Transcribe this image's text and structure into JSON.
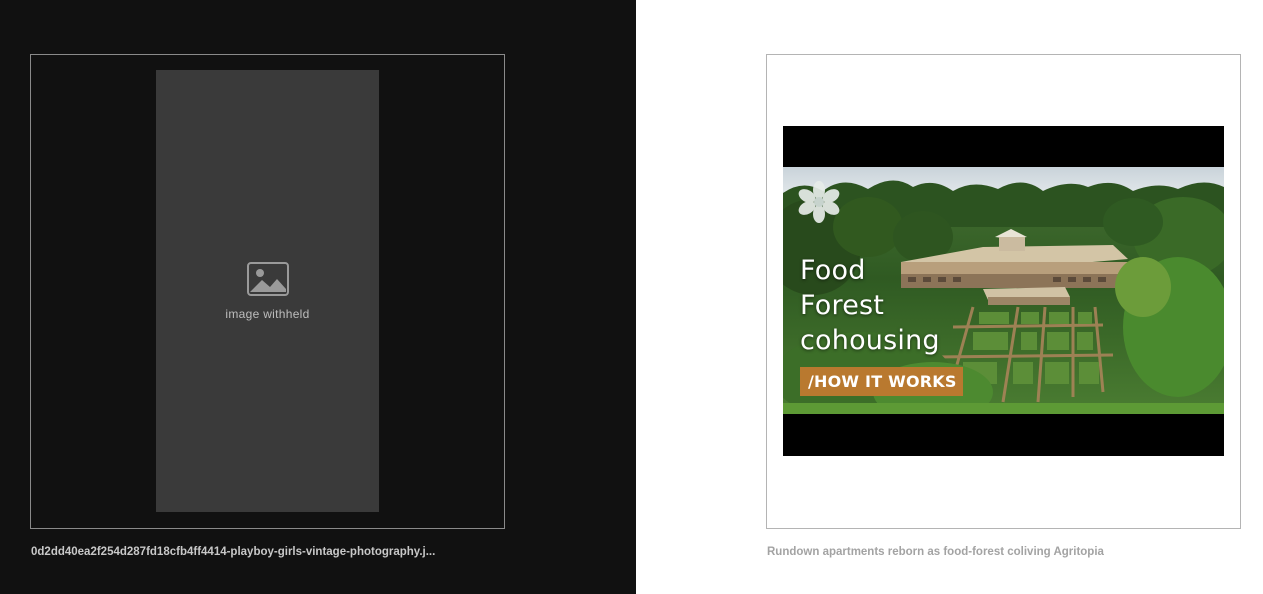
{
  "left_panel": {
    "caption": "0d2dd40ea2f254d287fd18cfb4ff4414-playboy-girls-vintage-photography.j...",
    "image_placeholder": "image withheld"
  },
  "right_panel": {
    "caption": "Rundown apartments reborn as food-forest coliving Agritopia",
    "thumbnail": {
      "title_lines": [
        "Food",
        "Forest",
        "cohousing"
      ],
      "badge": "/HOW IT WORKS",
      "badge_color": "#b9792f",
      "logo_icon": "flower-logo-icon"
    }
  }
}
